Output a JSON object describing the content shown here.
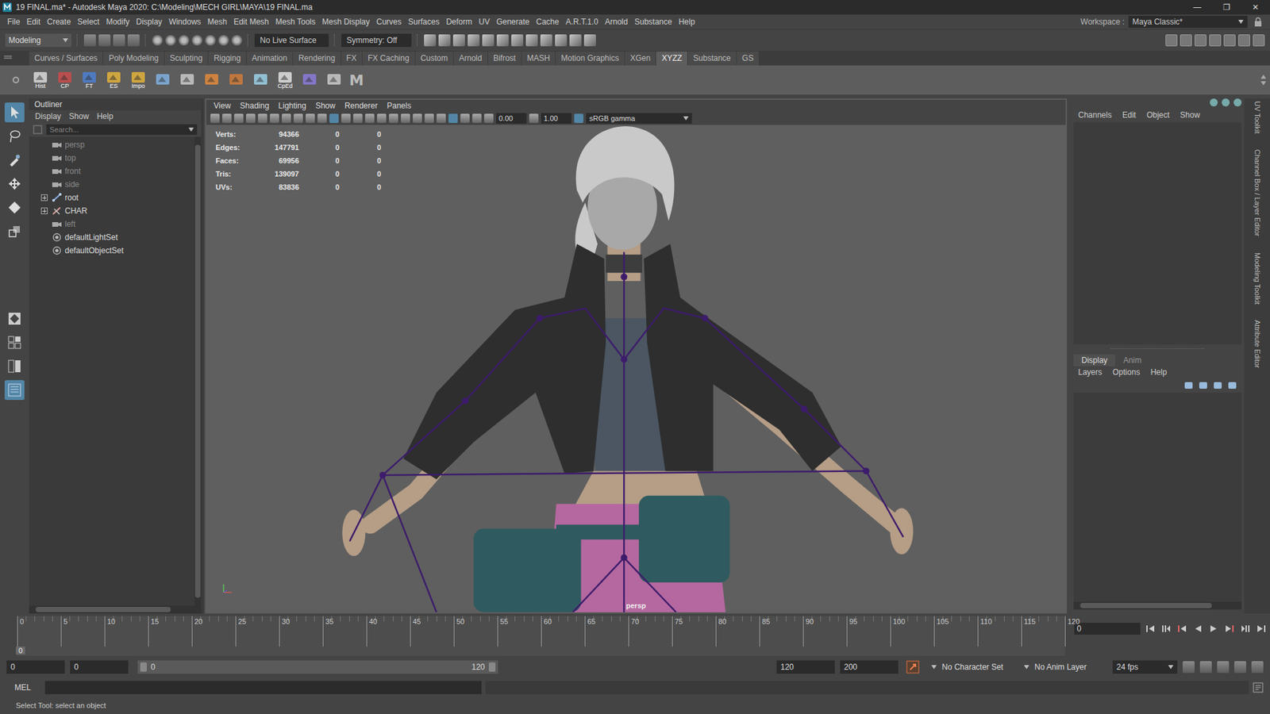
{
  "window": {
    "title": "19 FINAL.ma* - Autodesk Maya 2020: C:\\Modeling\\MECH GIRL\\MAYA\\19 FINAL.ma",
    "controls": [
      "—",
      "❐",
      "✕"
    ]
  },
  "menu_bar": [
    "File",
    "Edit",
    "Create",
    "Select",
    "Modify",
    "Display",
    "Windows",
    "Mesh",
    "Edit Mesh",
    "Mesh Tools",
    "Mesh Display",
    "Curves",
    "Surfaces",
    "Deform",
    "UV",
    "Generate",
    "Cache",
    "A.R.T.1.0",
    "Arnold",
    "Substance",
    "Help"
  ],
  "workspace": {
    "label": "Workspace :",
    "value": "Maya Classic*"
  },
  "status_line": {
    "mode": "Modeling",
    "live_surface": "No Live Surface",
    "symmetry": "Symmetry: Off"
  },
  "shelf_tabs": [
    {
      "label": "Curves / Surfaces",
      "selected": false
    },
    {
      "label": "Poly Modeling",
      "selected": false
    },
    {
      "label": "Sculpting",
      "selected": false
    },
    {
      "label": "Rigging",
      "selected": false
    },
    {
      "label": "Animation",
      "selected": false
    },
    {
      "label": "Rendering",
      "selected": false
    },
    {
      "label": "FX",
      "selected": false
    },
    {
      "label": "FX Caching",
      "selected": false
    },
    {
      "label": "Custom",
      "selected": false
    },
    {
      "label": "Arnold",
      "selected": false
    },
    {
      "label": "Bifrost",
      "selected": false
    },
    {
      "label": "MASH",
      "selected": false
    },
    {
      "label": "Motion Graphics",
      "selected": false
    },
    {
      "label": "XGen",
      "selected": false
    },
    {
      "label": "XYZZ",
      "selected": true
    },
    {
      "label": "Substance",
      "selected": false
    },
    {
      "label": "GS",
      "selected": false
    }
  ],
  "shelf": {
    "buttons": [
      {
        "kind": "labeled",
        "label": "Hist"
      },
      {
        "kind": "labeled",
        "label": "CP"
      },
      {
        "kind": "labeled",
        "label": "FT"
      },
      {
        "kind": "labeled",
        "label": "ES"
      },
      {
        "kind": "labeled",
        "label": "Impo"
      },
      {
        "kind": "icon",
        "label": ""
      },
      {
        "kind": "icon",
        "label": ""
      },
      {
        "kind": "icon",
        "label": ""
      },
      {
        "kind": "icon",
        "label": ""
      },
      {
        "kind": "icon",
        "label": ""
      },
      {
        "kind": "labeled",
        "label": "CpEd"
      },
      {
        "kind": "icon",
        "label": ""
      },
      {
        "kind": "icon",
        "label": ""
      }
    ],
    "logo": "M"
  },
  "outliner": {
    "title": "Outliner",
    "menu": [
      "Display",
      "Show",
      "Help"
    ],
    "search_placeholder": "Search...",
    "items": [
      {
        "label": "persp",
        "kind": "camera",
        "dimmed": true,
        "expandable": false
      },
      {
        "label": "top",
        "kind": "camera",
        "dimmed": true,
        "expandable": false
      },
      {
        "label": "front",
        "kind": "camera",
        "dimmed": true,
        "expandable": false
      },
      {
        "label": "side",
        "kind": "camera",
        "dimmed": true,
        "expandable": false
      },
      {
        "label": "root",
        "kind": "joint",
        "dimmed": false,
        "expandable": true
      },
      {
        "label": "CHAR",
        "kind": "group",
        "dimmed": false,
        "expandable": true
      },
      {
        "label": "left",
        "kind": "camera",
        "dimmed": true,
        "expandable": false
      },
      {
        "label": "defaultLightSet",
        "kind": "set",
        "dimmed": false,
        "expandable": false
      },
      {
        "label": "defaultObjectSet",
        "kind": "set",
        "dimmed": false,
        "expandable": false
      }
    ]
  },
  "viewport": {
    "menu": [
      "View",
      "Shading",
      "Lighting",
      "Show",
      "Renderer",
      "Panels"
    ],
    "exposure": "0.00",
    "gamma": "1.00",
    "color_space": "sRGB gamma",
    "hud": [
      {
        "label": "Verts:",
        "values": [
          "94366",
          "0",
          "0"
        ]
      },
      {
        "label": "Edges:",
        "values": [
          "147791",
          "0",
          "0"
        ]
      },
      {
        "label": "Faces:",
        "values": [
          "69956",
          "0",
          "0"
        ]
      },
      {
        "label": "Tris:",
        "values": [
          "139097",
          "0",
          "0"
        ]
      },
      {
        "label": "UVs:",
        "values": [
          "83836",
          "0",
          "0"
        ]
      }
    ],
    "camera": "persp"
  },
  "channel_box": {
    "menu": [
      "Channels",
      "Edit",
      "Object",
      "Show"
    ]
  },
  "layer_editor": {
    "tabs": [
      {
        "label": "Display",
        "selected": true
      },
      {
        "label": "Anim",
        "selected": false
      }
    ],
    "menu": [
      "Layers",
      "Options",
      "Help"
    ]
  },
  "side_tabs": [
    "UV Toolkit",
    "Channel Box / Layer Editor",
    "Modeling Toolkit",
    "Attribute Editor"
  ],
  "timeline": {
    "ticks": [
      "0",
      "5",
      "10",
      "15",
      "20",
      "25",
      "30",
      "35",
      "40",
      "45",
      "50",
      "55",
      "60",
      "65",
      "70",
      "75",
      "80",
      "85",
      "90",
      "95",
      "100",
      "105",
      "110",
      "115",
      "120"
    ],
    "current_frame": "0",
    "frame_field": "0"
  },
  "range": {
    "start": "0",
    "playback_start": "0",
    "slider_start": "0",
    "slider_end": "120",
    "playback_end": "120",
    "end": "200",
    "character_set": "No Character Set",
    "anim_layer": "No Anim Layer",
    "fps": "24 fps"
  },
  "command_line": {
    "language": "MEL"
  },
  "help_line": "Select Tool: select an object"
}
